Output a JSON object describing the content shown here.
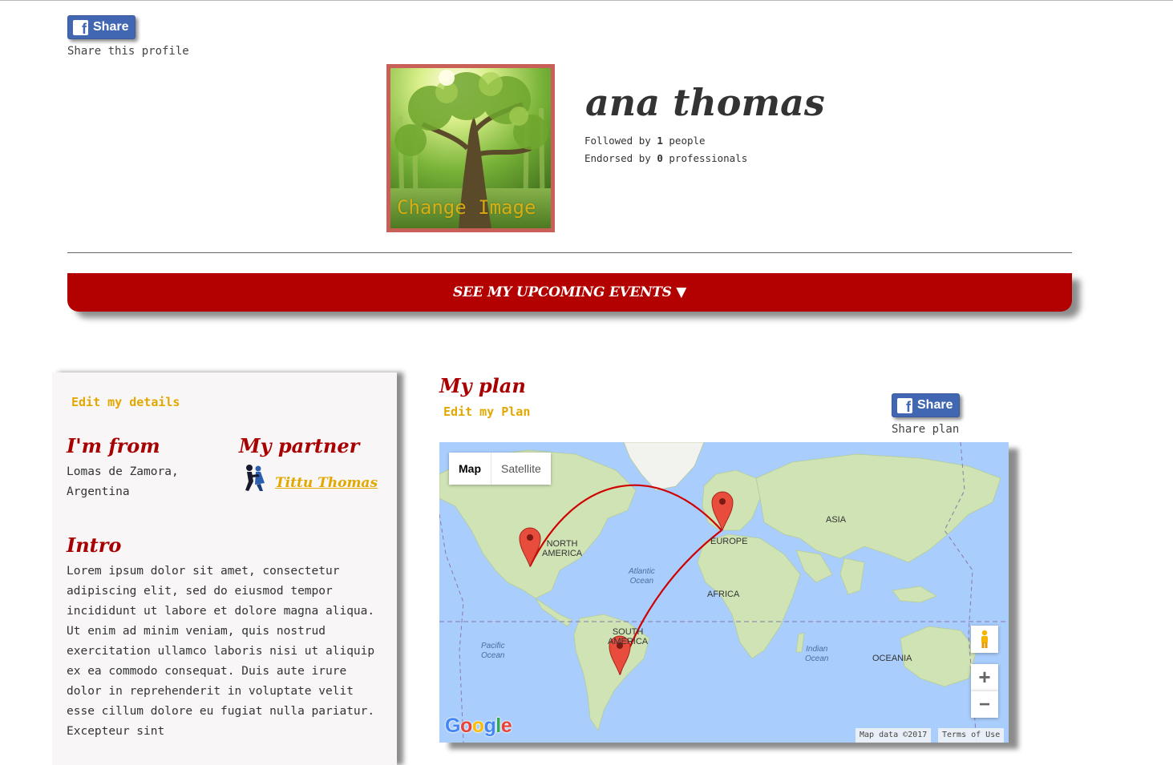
{
  "top_share": {
    "button_label": "Share",
    "caption": "Share this profile"
  },
  "profile": {
    "name": "ana thomas",
    "change_image_label": "Change Image",
    "followed_prefix": "Followed by",
    "followed_count": "1",
    "followed_suffix": "people",
    "endorsed_prefix": "Endorsed by",
    "endorsed_count": "0",
    "endorsed_suffix": "professionals"
  },
  "events_button": {
    "label": "SEE MY UPCOMING EVENTS ▼"
  },
  "left_panel": {
    "edit_details_label": "Edit my details",
    "from_heading": "I'm from",
    "from_line1": "Lomas de Zamora,",
    "from_line2": "Argentina",
    "partner_heading": "My partner",
    "partner_name": "Tittu Thomas",
    "intro_heading": "Intro",
    "intro_lines": [
      "Lorem ipsum dolor sit amet, consectetur",
      "adipiscing elit, sed do eiusmod tempor",
      "incididunt ut labore et dolore magna aliqua.",
      "Ut enim ad minim veniam, quis nostrud",
      "exercitation ullamco laboris nisi ut aliquip",
      "ex ea commodo consequat. Duis aute irure",
      "dolor in reprehenderit in voluptate velit",
      "esse cillum dolore eu fugiat nulla pariatur.",
      "Excepteur sint"
    ]
  },
  "plan": {
    "heading": "My plan",
    "edit_label": "Edit my Plan",
    "share_button_label": "Share",
    "share_caption": "Share plan"
  },
  "map": {
    "type_map": "Map",
    "type_satellite": "Satellite",
    "zoom_in": "+",
    "zoom_out": "−",
    "labels": {
      "north_america_1": "NORTH",
      "north_america_2": "AMERICA",
      "south_america_1": "SOUTH",
      "south_america_2": "AMERICA",
      "europe": "EUROPE",
      "asia": "ASIA",
      "africa": "AFRICA",
      "oceania": "OCEANIA",
      "atlantic_1": "Atlantic",
      "atlantic_2": "Ocean",
      "pacific_1": "Pacific",
      "pacific_2": "Ocean",
      "indian_1": "Indian",
      "indian_2": "Ocean"
    },
    "google_logo": "Google",
    "footer_data": "Map data ©2017",
    "footer_terms": "Terms of Use",
    "route_color": "#d00000",
    "marker_color": "#e74c3c",
    "land_color": "#cfe3b4",
    "water_color": "#a9cdfc"
  },
  "colors": {
    "accent_red": "#b30000",
    "heading_red": "#a80000",
    "link_yellow": "#e2a800",
    "facebook_blue": "#4267b2"
  }
}
